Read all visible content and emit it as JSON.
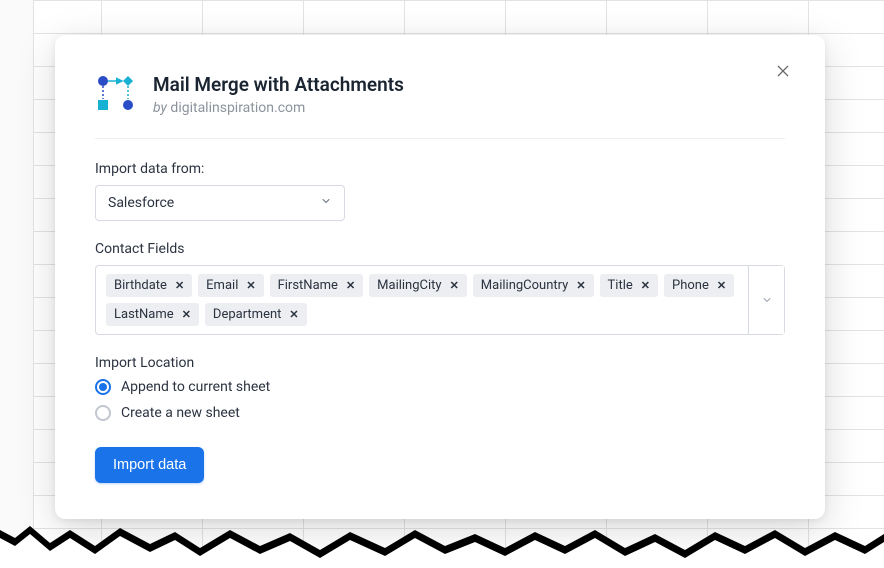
{
  "header": {
    "title": "Mail Merge with Attachments",
    "by_prefix": "by ",
    "by_name": "digitalinspiration.com"
  },
  "source": {
    "label": "Import data from:",
    "selected": "Salesforce"
  },
  "fields": {
    "label": "Contact Fields",
    "items": [
      "Birthdate",
      "Email",
      "FirstName",
      "MailingCity",
      "MailingCountry",
      "Title",
      "Phone",
      "LastName",
      "Department"
    ]
  },
  "location": {
    "label": "Import Location",
    "options": [
      {
        "label": "Append to current sheet",
        "checked": true
      },
      {
        "label": "Create a new sheet",
        "checked": false
      }
    ]
  },
  "buttons": {
    "import": "Import data"
  }
}
